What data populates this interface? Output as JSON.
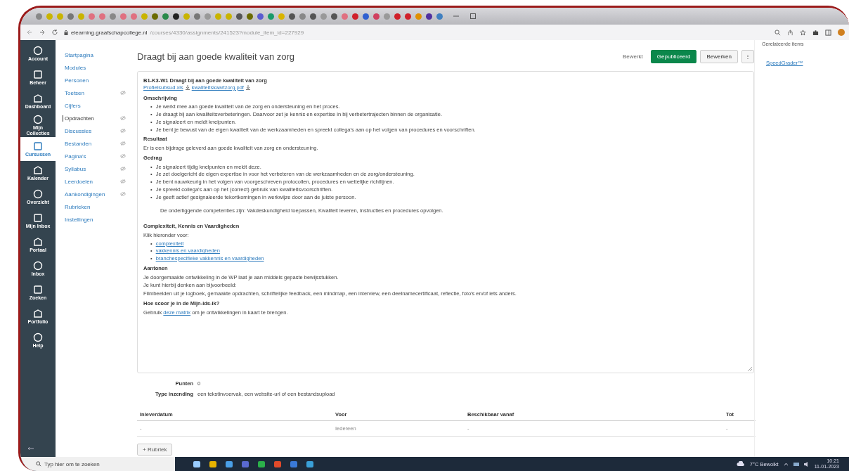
{
  "browser": {
    "url_host": "elearning.graafschapcollege.nl",
    "url_path": "/courses/4330/assignments/241523?module_item_id=227929"
  },
  "global_nav": [
    {
      "label": "Account",
      "selected": false
    },
    {
      "label": "Beheer",
      "selected": false
    },
    {
      "label": "Dashboard",
      "selected": false
    },
    {
      "label": "Mijn Collecties",
      "selected": false
    },
    {
      "label": "Cursussen",
      "selected": true
    },
    {
      "label": "Kalender",
      "selected": false
    },
    {
      "label": "Overzicht",
      "selected": false
    },
    {
      "label": "Mijn Inbox",
      "selected": false
    },
    {
      "label": "Portaal",
      "selected": false
    },
    {
      "label": "Inbox",
      "selected": false
    },
    {
      "label": "Zoeken",
      "selected": false
    },
    {
      "label": "Portfolio",
      "selected": false
    },
    {
      "label": "Help",
      "selected": false
    }
  ],
  "course_nav": [
    {
      "label": "Startpagina",
      "selected": false,
      "hidden": false
    },
    {
      "label": "Modules",
      "selected": false,
      "hidden": false
    },
    {
      "label": "Personen",
      "selected": false,
      "hidden": false
    },
    {
      "label": "Toetsen",
      "selected": false,
      "hidden": true
    },
    {
      "label": "Cijfers",
      "selected": false,
      "hidden": false
    },
    {
      "label": "Opdrachten",
      "selected": true,
      "hidden": true
    },
    {
      "label": "Discussies",
      "selected": false,
      "hidden": true
    },
    {
      "label": "Bestanden",
      "selected": false,
      "hidden": true
    },
    {
      "label": "Pagina's",
      "selected": false,
      "hidden": true
    },
    {
      "label": "Syllabus",
      "selected": false,
      "hidden": true
    },
    {
      "label": "Leerdoelen",
      "selected": false,
      "hidden": true
    },
    {
      "label": "Aankondigingen",
      "selected": false,
      "hidden": true
    },
    {
      "label": "Rubrieken",
      "selected": false,
      "hidden": false
    },
    {
      "label": "Instellingen",
      "selected": false,
      "hidden": false
    }
  ],
  "page_title": "Draagt bij aan goede kwaliteit van zorg",
  "actions": {
    "student_view": "Bewerkt",
    "published": "Gepubliceerd",
    "edit": "Bewerken",
    "more": "⋮"
  },
  "sidebar": {
    "heading": "Gerelateerde items",
    "link": "SpeedGrader™"
  },
  "description": [
    {
      "kind": "title",
      "text": "B1-K3-W1 Draagt bij aan goede kwaliteit van zorg"
    },
    {
      "kind": "files",
      "items": [
        "Profielsubsud.xls",
        "kwaliteitskaartzorg.pdf"
      ]
    },
    {
      "kind": "heading",
      "text": "Omschrijving"
    },
    {
      "kind": "list",
      "marker": "•",
      "items": [
        "Je werkt mee aan goede kwaliteit van de zorg en ondersteuning en het proces.",
        "Je draagt bij aan kwaliteitsverbeteringen. Daarvoor zet je kennis en expertise in bij verbetertrajecten binnen de organisatie.",
        "Je signaleert en meldt knelpunten.",
        "Je bent je bewust van de eigen kwaliteit van de werkzaamheden en spreekt collega's aan op het volgen van procedures en voorschriften."
      ]
    },
    {
      "kind": "heading",
      "text": "Resultaat"
    },
    {
      "kind": "paragraph",
      "text": "Er is een bijdrage geleverd aan goede kwaliteit van zorg en ondersteuning."
    },
    {
      "kind": "heading",
      "text": "Gedrag"
    },
    {
      "kind": "list",
      "marker": "•",
      "items": [
        "Je signaleert tijdig knelpunten en meldt deze.",
        "Je zet doelgericht de eigen expertise in voor het verbeteren van de werkzaamheden en de zorg/ondersteuning.",
        "Je bent nauwkeurig in het volgen van voorgeschreven protocollen, procedures en wettelijke richtlijnen.",
        "Je spreekt collega's aan op het (correct) gebruik van kwaliteitsvoorschriften.",
        "Je geeft actief gesignaleerde tekortkomingen in werkwijze door aan de juiste persoon."
      ]
    },
    {
      "kind": "indented",
      "text": "De onderliggende competenties zijn: Vakdeskundigheid toepassen, Kwaliteit leveren, Instructies en procedures opvolgen."
    },
    {
      "kind": "heading",
      "text": "Complexiteit, Kennis en Vaardigheden"
    },
    {
      "kind": "paragraph",
      "text": "Klik hieronder voor:"
    },
    {
      "kind": "links",
      "marker": "•",
      "items": [
        "complexiteit",
        "vakkennis en vaardigheden",
        "branchespecifieke vakkennis en vaardigheden"
      ]
    },
    {
      "kind": "heading",
      "text": "Aantonen"
    },
    {
      "kind": "paragraph",
      "text": "Je doorgemaakte ontwikkeling in de WP laat je aan middels gepaste bewijsstukken."
    },
    {
      "kind": "paragraph",
      "text": "Je kunt hierbij denken aan bijvoorbeeld:"
    },
    {
      "kind": "paragraph",
      "text": "Filmbeelden uit je logboek, gemaakte opdrachten, schriftelijke feedback, een mindmap, een interview, een deelnamecertificaat, reflectie, foto's en/of iets anders."
    },
    {
      "kind": "heading",
      "text": "Hoe scoor je in de Mijn-ids-ik?"
    },
    {
      "kind": "link_para",
      "before": "Gebruik ",
      "link": "deze matrix",
      "after": " om je ontwikkelingen in kaart te brengen."
    }
  ],
  "details": [
    {
      "label": "Punten",
      "value": "0"
    },
    {
      "label": "Type inzending",
      "value": "een tekstinvoervak, een website-url of een bestandsupload"
    }
  ],
  "dates": {
    "columns": [
      "Inleverdatum",
      "Voor",
      "Beschikbaar vanaf",
      "Tot"
    ],
    "rows": [
      [
        "-",
        "Iedereen",
        "-",
        "-"
      ]
    ]
  },
  "rubric_button": "+ Rubriek",
  "taskbar": {
    "search_placeholder": "Typ hier om te zoeken",
    "weather": "7°C Bewolkt",
    "time": "10:21",
    "date": "11-01-2023"
  }
}
